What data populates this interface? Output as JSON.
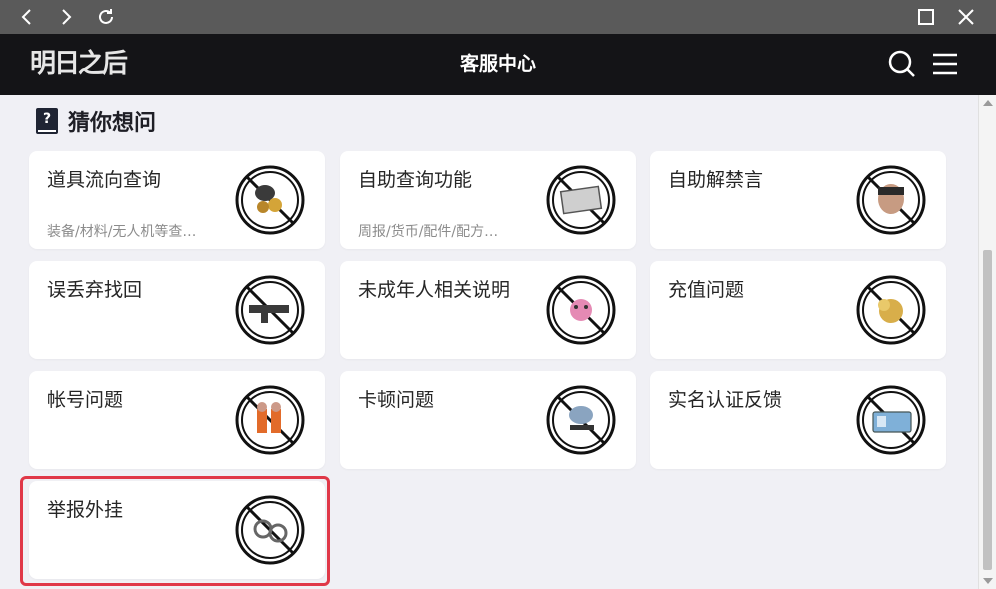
{
  "header": {
    "logo_text": "明日之后",
    "title": "客服中心"
  },
  "section": {
    "title": "猜你想问",
    "icon_glyph": "?"
  },
  "cards": [
    {
      "title": "道具流向查询",
      "subtitle": "装备/材料/无人机等查…",
      "icon": "helmet-gold-item-icon"
    },
    {
      "title": "自助查询功能",
      "subtitle": "周报/货币/配件/配方…",
      "icon": "document-scroll-icon"
    },
    {
      "title": "自助解禁言",
      "subtitle": "",
      "icon": "masked-character-icon"
    },
    {
      "title": "误丢弃找回",
      "subtitle": "",
      "icon": "machine-gun-icon"
    },
    {
      "title": "未成年人相关说明",
      "subtitle": "",
      "icon": "pink-plush-toy-icon"
    },
    {
      "title": "充值问题",
      "subtitle": "",
      "icon": "gold-treasure-icon"
    },
    {
      "title": "帐号问题",
      "subtitle": "",
      "icon": "orange-team-characters-icon"
    },
    {
      "title": "卡顿问题",
      "subtitle": "",
      "icon": "satellite-dish-icon"
    },
    {
      "title": "实名认证反馈",
      "subtitle": "",
      "icon": "id-card-icon"
    },
    {
      "title": "举报外挂",
      "subtitle": "",
      "icon": "handcuffs-icon"
    }
  ],
  "colors": {
    "header_bg": "#141417",
    "page_bg": "#f0f0f5",
    "highlight": "#e03848"
  }
}
